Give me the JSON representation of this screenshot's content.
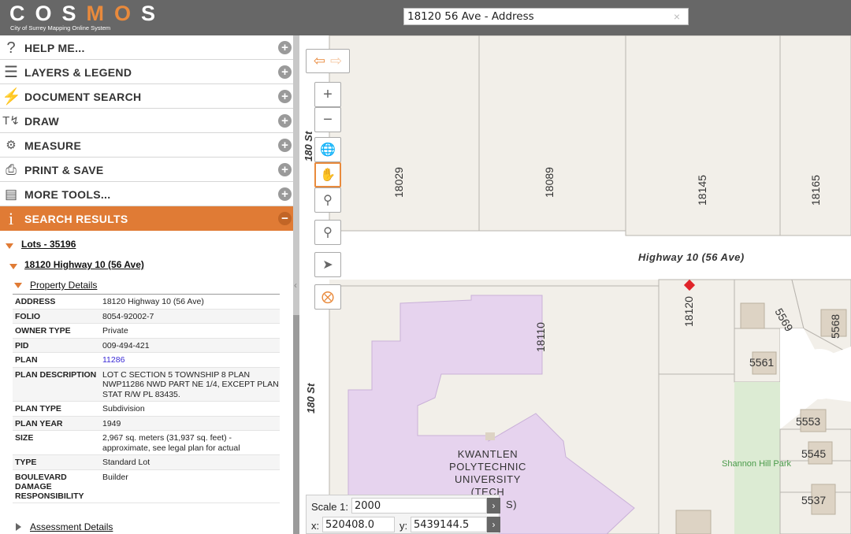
{
  "app": {
    "logo_text": "COSMOS",
    "logo_subtitle": "City of Surrey Mapping Online System"
  },
  "search": {
    "value": "18120 56 Ave - Address",
    "clear_glyph": "×"
  },
  "menu": [
    {
      "label": "HELP ME...",
      "icon": "question-icon"
    },
    {
      "label": "LAYERS & LEGEND",
      "icon": "layers-icon"
    },
    {
      "label": "DOCUMENT SEARCH",
      "icon": "lightning-icon"
    },
    {
      "label": "DRAW",
      "icon": "draw-icon"
    },
    {
      "label": "MEASURE",
      "icon": "ruler-icon"
    },
    {
      "label": "PRINT & SAVE",
      "icon": "printer-icon"
    },
    {
      "label": "MORE TOOLS...",
      "icon": "toolbox-icon"
    },
    {
      "label": "SEARCH RESULTS",
      "icon": "info-icon"
    }
  ],
  "results": {
    "group": "Lots - 35196",
    "item": "18120 Highway 10 (56 Ave)",
    "property_details_label": "Property Details",
    "assessment_details_label": "Assessment Details",
    "properties": [
      {
        "key": "ADDRESS",
        "value": "18120 Highway 10 (56 Ave)"
      },
      {
        "key": "FOLIO",
        "value": "8054-92002-7"
      },
      {
        "key": "OWNER TYPE",
        "value": "Private"
      },
      {
        "key": "PID",
        "value": "009-494-421"
      },
      {
        "key": "PLAN",
        "value": "11286"
      },
      {
        "key": "PLAN DESCRIPTION",
        "value": "LOT C SECTION 5 TOWNSHIP 8 PLAN NWP11286 NWD PART NE 1/4, EXCEPT PLAN STAT R/W PL 83435."
      },
      {
        "key": "PLAN TYPE",
        "value": "Subdivision"
      },
      {
        "key": "PLAN YEAR",
        "value": "1949"
      },
      {
        "key": "SIZE",
        "value": "2,967 sq. meters (31,937 sq. feet) - approximate, see legal plan for actual"
      },
      {
        "key": "TYPE",
        "value": "Standard Lot"
      },
      {
        "key": "BOULEVARD DAMAGE RESPONSIBILITY",
        "value": "Builder"
      }
    ]
  },
  "map": {
    "labels": {
      "lot_18029": "18029",
      "lot_18089": "18089",
      "lot_18145": "18145",
      "lot_18165": "18165",
      "lot_18120": "18120",
      "lot_18110": "18110",
      "lot_5569": "5569",
      "lot_5568": "5568",
      "lot_5561": "5561",
      "lot_5553": "5553",
      "lot_5545": "5545",
      "lot_5537": "5537",
      "street_highway": "Highway 10 (56 Ave)",
      "street_180": "180 St",
      "street_180_top": "180 St",
      "park": "Shannon Hill Park",
      "kpu_line1": "KWANTLEN",
      "kpu_line2": "POLYTECHNIC",
      "kpu_line3": "UNIVERSITY",
      "kpu_line4": "(TECH",
      "kpu_line5": "S)"
    },
    "colors": {
      "background": "#f2efe9",
      "road": "#ffffff",
      "kpu": "#e6d3ee",
      "park": "#dcebd3",
      "marker": "#e0242a",
      "accent": "#e07b35"
    }
  },
  "scale": {
    "scale_label": "Scale 1:",
    "scale_value": "2000",
    "x_label": "x:",
    "x_value": "520408.0",
    "y_label": "y:",
    "y_value": "5439144.5",
    "go_glyph": "›"
  }
}
